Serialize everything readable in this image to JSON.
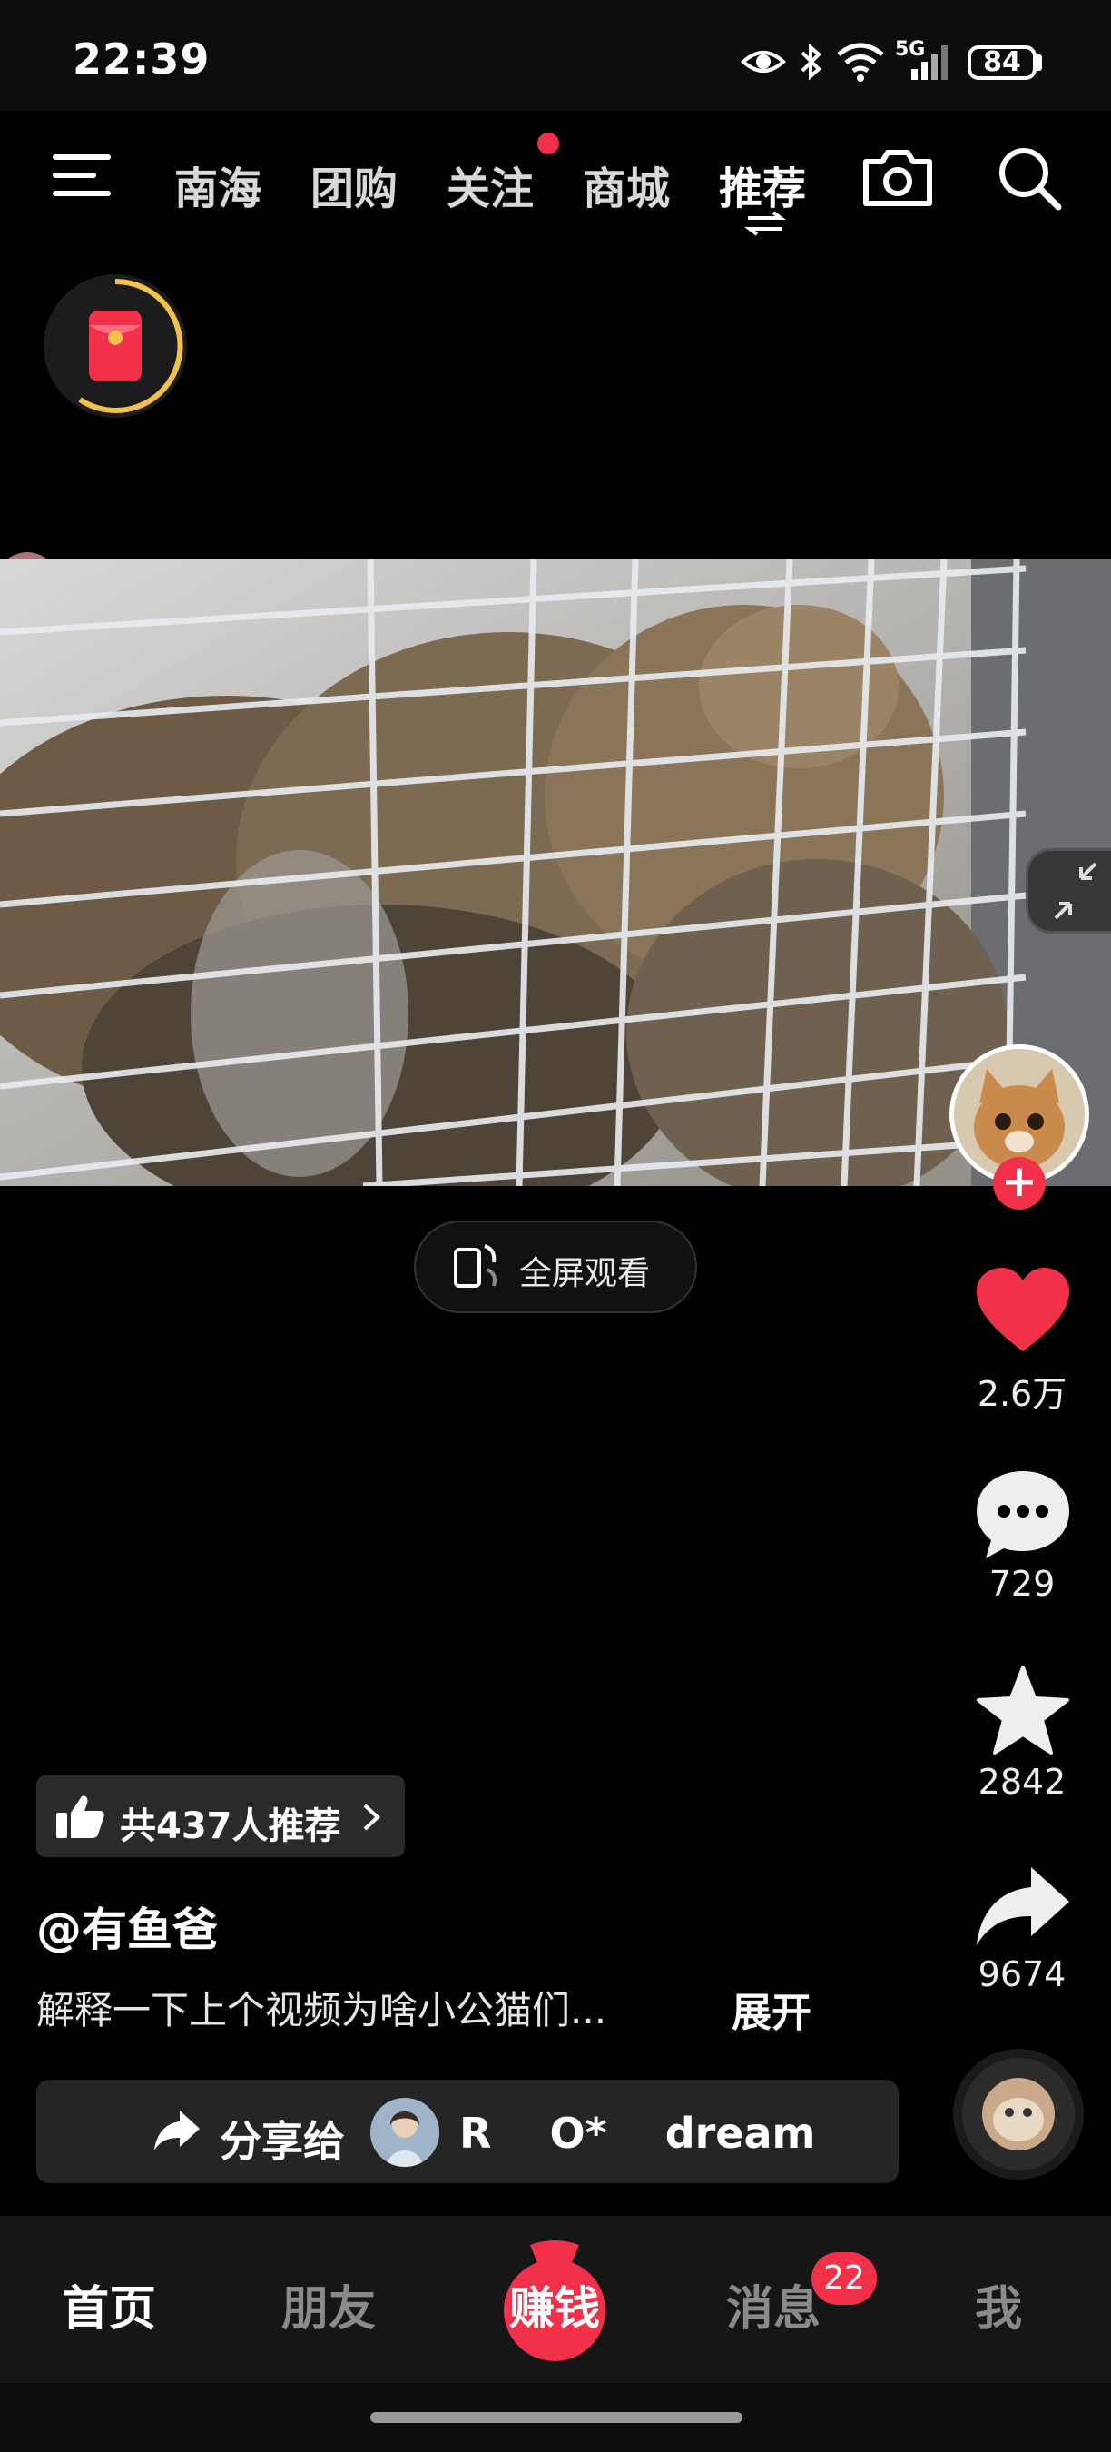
{
  "status_bar": {
    "time": "22:39",
    "battery": "84",
    "network": "5G"
  },
  "top_nav": {
    "tabs": [
      {
        "label": "南海"
      },
      {
        "label": "团购"
      },
      {
        "label": "关注"
      },
      {
        "label": "商城"
      },
      {
        "label": "推荐"
      }
    ],
    "active_tab": "推荐"
  },
  "video": {
    "fullscreen_label": "全屏观看"
  },
  "actions": {
    "likes": "2.6万",
    "comments": "729",
    "favorites": "2842",
    "shares": "9674"
  },
  "post": {
    "recommend_text": "共437人推荐",
    "author": "@有鱼爸",
    "description": "解释一下上个视频为啥小公猫们...",
    "expand_label": "展开"
  },
  "share": {
    "label": "分享给",
    "recipients": "R    O*    dream"
  },
  "bottom_tabs": {
    "home": "首页",
    "friends": "朋友",
    "earn": "赚钱",
    "messages": "消息",
    "messages_badge": "22",
    "me": "我"
  },
  "colors": {
    "accent": "#f1304a",
    "ring": "#f0c24a"
  }
}
